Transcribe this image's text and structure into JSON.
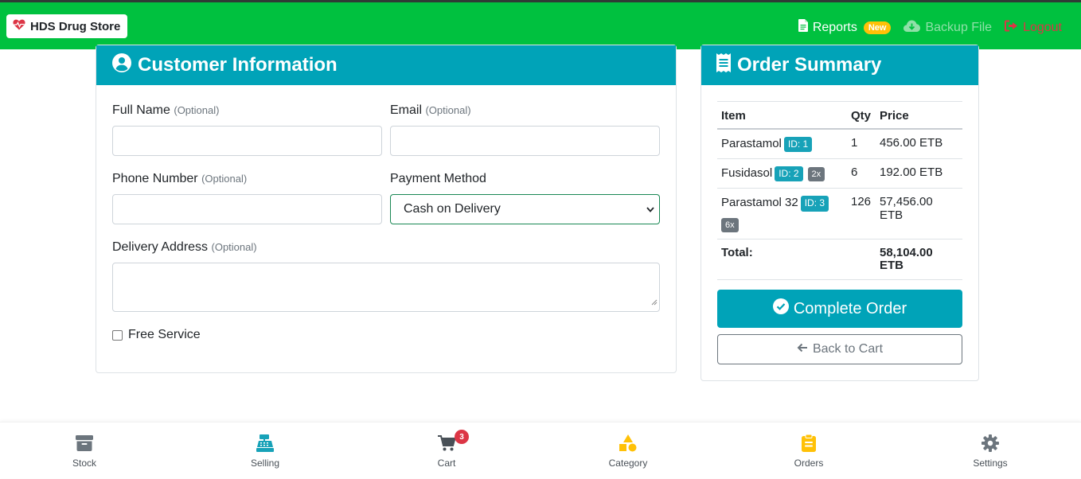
{
  "navbar": {
    "brand": "HDS Drug Store",
    "reports_label": "Reports",
    "reports_badge": "New",
    "backup_label": "Backup File",
    "logout_label": "Logout"
  },
  "customer": {
    "title": "Customer Information",
    "full_name_label": "Full Name",
    "email_label": "Email",
    "phone_label": "Phone Number",
    "payment_label": "Payment Method",
    "address_label": "Delivery Address",
    "optional_text": "(Optional)",
    "full_name_value": "",
    "email_value": "",
    "phone_value": "",
    "payment_value": "Cash on Delivery",
    "address_value": "",
    "free_service_label": "Free Service",
    "free_service_checked": false
  },
  "summary": {
    "title": "Order Summary",
    "columns": [
      "Item",
      "Qty",
      "Price"
    ],
    "rows": [
      {
        "item": "Parastamol",
        "id": "ID: 1",
        "multiplier": "",
        "qty": "1",
        "price": "456.00 ETB"
      },
      {
        "item": "Fusidasol",
        "id": "ID: 2",
        "multiplier": "2x",
        "qty": "6",
        "price": "192.00 ETB"
      },
      {
        "item": "Parastamol 32",
        "id": "ID: 3",
        "multiplier": "6x",
        "qty": "126",
        "price": "57,456.00 ETB"
      }
    ],
    "total_label": "Total:",
    "total_value": "58,104.00 ETB",
    "complete_label": "Complete Order",
    "back_label": "Back to Cart"
  },
  "bottom_nav": {
    "items": [
      {
        "label": "Stock",
        "icon": "archive-icon",
        "color": "#6c757d"
      },
      {
        "label": "Selling",
        "icon": "cash-register-icon",
        "color": "#17a2b8"
      },
      {
        "label": "Cart",
        "icon": "cart-icon",
        "color": "#495057"
      },
      {
        "label": "Category",
        "icon": "shapes-icon",
        "color": "#ffc107"
      },
      {
        "label": "Orders",
        "icon": "clipboard-icon",
        "color": "#ffc107"
      },
      {
        "label": "Settings",
        "icon": "gear-icon",
        "color": "#6c757d"
      }
    ],
    "cart_count": "3"
  },
  "colors": {
    "navbar": "#00c13f",
    "card_header": "#00a3b8",
    "accent_badge": "#17a2b8",
    "logout": "#dc3545"
  }
}
